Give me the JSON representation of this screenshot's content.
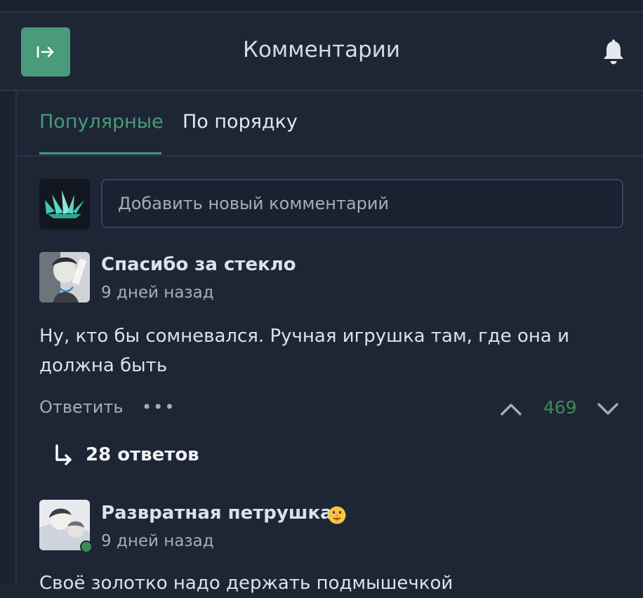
{
  "header": {
    "title": "Комментарии",
    "exit_icon": "exit-arrow-icon",
    "bell_icon": "bell-icon"
  },
  "tabs": [
    {
      "label": "Популярные",
      "active": true
    },
    {
      "label": "По порядку",
      "active": false
    }
  ],
  "composer": {
    "placeholder": "Добавить новый комментарий"
  },
  "comments": [
    {
      "username": "Спасибо за стекло",
      "time": "9 дней назад",
      "text": "Ну, кто бы сомневался. Ручная игрушка там, где она и должна быть",
      "reply_label": "Ответить",
      "more_label": "•••",
      "votes": "469",
      "replies_label": "28 ответов"
    },
    {
      "username": "Развратная петрушка",
      "time": "9 дней назад",
      "text": "Своё золотко надо держать подмышечкой",
      "online": true,
      "emoji": "shushing-face-icon"
    }
  ],
  "colors": {
    "accent": "#4a9a7c",
    "vote_positive": "#3d8c55",
    "background": "#1e2636"
  }
}
